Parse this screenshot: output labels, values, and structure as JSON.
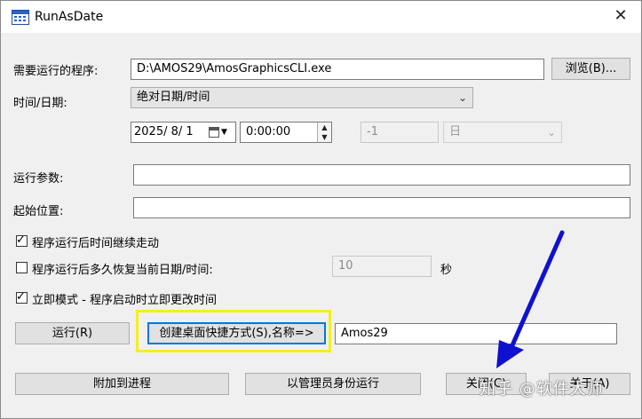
{
  "window": {
    "title": "RunAsDate",
    "close_glyph": "✕"
  },
  "form": {
    "program_label": "需要运行的程序:",
    "program_value": "D:\\AMOS29\\AmosGraphicsCLI.exe",
    "browse_label": "浏览(B)...",
    "datetime_label": "时间/日期:",
    "datetime_mode": "绝对日期/时间",
    "date_value": "2025/  8/  1",
    "time_value": "0:00:00",
    "offset_value": "-1",
    "offset_unit": "日",
    "params_label": "运行参数:",
    "params_value": "",
    "startdir_label": "起始位置:",
    "startdir_value": ""
  },
  "options": {
    "keep_running_label": "程序运行后时间继续走动",
    "keep_running_checked": true,
    "restore_label": "程序运行后多久恢复当前日期/时间:",
    "restore_checked": false,
    "restore_seconds": "10",
    "restore_unit": "秒",
    "immediate_label": "立即模式 - 程序启动时立即更改时间",
    "immediate_checked": true
  },
  "actions": {
    "run_label": "运行(R)",
    "shortcut_label": "创建桌面快捷方式(S),名称=>",
    "shortcut_name": "Amos29",
    "attach_label": "附加到进程",
    "run_admin_label": "以管理员身份运行",
    "close_label": "关闭(C)",
    "about_label": "关于(A)"
  },
  "overlay": {
    "watermark": "知乎 @软件大师",
    "highlight_color": "#f5ef1a",
    "arrow_color": "#1010d0"
  }
}
